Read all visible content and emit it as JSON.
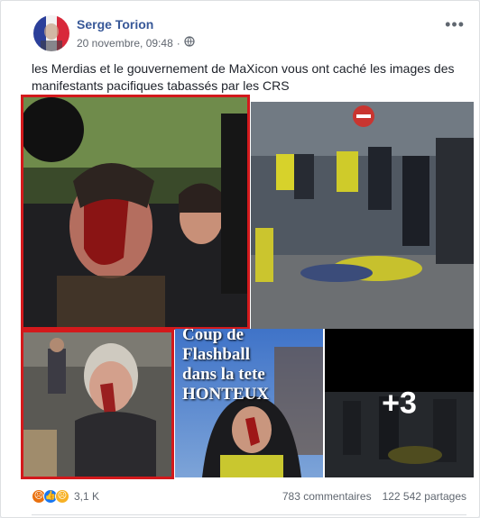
{
  "post": {
    "author": "Serge Torion",
    "timestamp": "20 novembre, 09:48",
    "privacy_icon": "globe-icon",
    "text": "les Merdias et le gouvernement de MaXicon vous ont caché les images des manifestants pacifiques tabassés par les CRS",
    "more_label": "•••"
  },
  "photos": {
    "overlay_text_line1": "Coup de",
    "overlay_text_line2": "Flashball",
    "overlay_text_line3": "dans la tete",
    "overlay_text_line4": "HONTEUX",
    "more_count": "+3"
  },
  "footer": {
    "reaction_icons": [
      "angry-icon",
      "like-icon",
      "sad-icon"
    ],
    "reactions_count": "3,1 K",
    "comments": "783 commentaires",
    "shares": "122 542 partages"
  },
  "colors": {
    "author_link": "#385898",
    "highlight_border": "#d3191c"
  }
}
